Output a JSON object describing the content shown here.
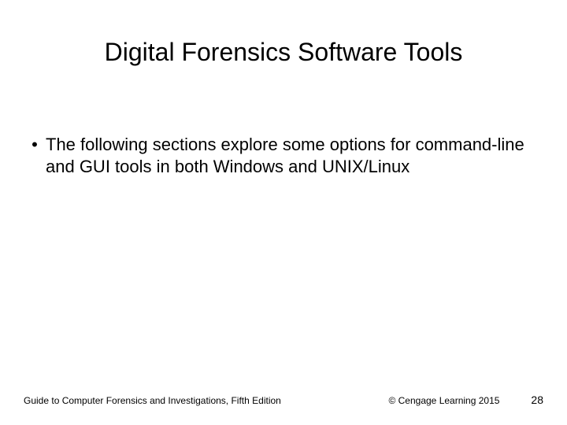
{
  "title": "Digital Forensics Software Tools",
  "bullets": [
    {
      "text": "The following sections explore some options for command-line and GUI tools in both Windows and UNIX/Linux"
    }
  ],
  "footer": {
    "left": "Guide to Computer Forensics and Investigations, Fifth Edition",
    "copyright": "© Cengage Learning  2015",
    "page": "28"
  }
}
